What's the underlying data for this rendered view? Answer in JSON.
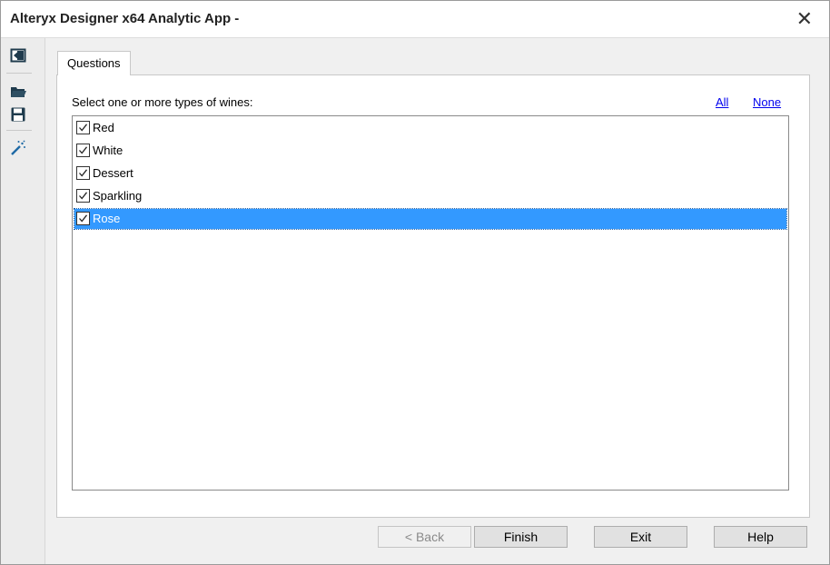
{
  "window": {
    "title": "Alteryx Designer x64 Analytic App -",
    "close_label": "✕"
  },
  "sidebar": {
    "icons": [
      {
        "name": "back-to-workflow-icon"
      },
      {
        "name": "open-folder-icon"
      },
      {
        "name": "save-icon"
      },
      {
        "name": "magic-wand-icon"
      }
    ]
  },
  "tab": {
    "label": "Questions"
  },
  "question": {
    "prompt": "Select one or more types of wines:",
    "all_label": "All",
    "none_label": "None",
    "items": [
      {
        "label": "Red",
        "checked": true,
        "selected": false
      },
      {
        "label": "White",
        "checked": true,
        "selected": false
      },
      {
        "label": "Dessert",
        "checked": true,
        "selected": false
      },
      {
        "label": "Sparkling",
        "checked": true,
        "selected": false
      },
      {
        "label": "Rose",
        "checked": true,
        "selected": true
      }
    ]
  },
  "buttons": {
    "back": "< Back",
    "finish": "Finish",
    "exit": "Exit",
    "help": "Help"
  },
  "colors": {
    "selection": "#3399ff",
    "link": "#0000ee",
    "icon": "#1f3b4d"
  }
}
